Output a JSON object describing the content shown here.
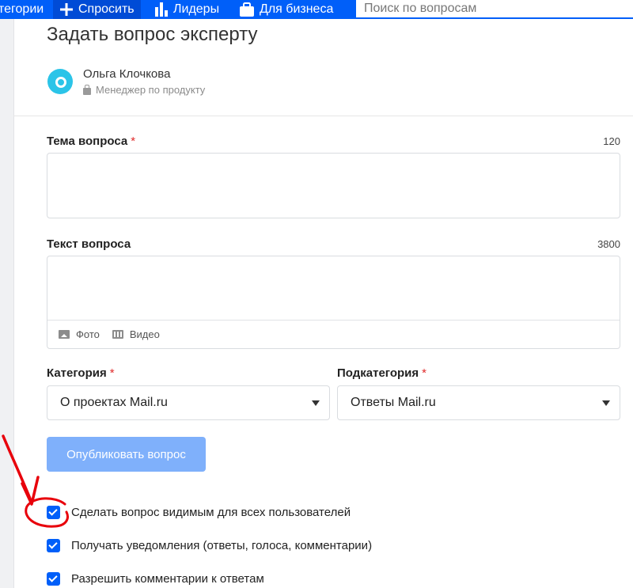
{
  "nav": {
    "categories_label": "тегории",
    "ask_label": "Спросить",
    "leaders_label": "Лидеры",
    "business_label": "Для бизнеса",
    "search_placeholder": "Поиск по вопросам",
    "icons": [
      "plus-icon",
      "bar-chart-icon",
      "briefcase-icon"
    ]
  },
  "page": {
    "title": "Задать вопрос эксперту"
  },
  "expert": {
    "name": "Ольга Клочкова",
    "role": "Менеджер по продукту"
  },
  "form": {
    "topic": {
      "label": "Тема вопроса",
      "required_mark": "*",
      "counter": "120",
      "value": ""
    },
    "text": {
      "label": "Текст вопроса",
      "counter": "3800",
      "value": "",
      "photo_label": "Фото",
      "video_label": "Видео"
    },
    "category": {
      "label": "Категория",
      "required_mark": "*",
      "value": "О проектах Mail.ru"
    },
    "subcategory": {
      "label": "Подкатегория",
      "required_mark": "*",
      "value": "Ответы Mail.ru"
    },
    "publish_label": "Опубликовать вопрос",
    "options": [
      {
        "label": "Сделать вопрос видимым для всех пользователей",
        "checked": true
      },
      {
        "label": "Получать уведомления (ответы, голоса, комментарии)",
        "checked": true
      },
      {
        "label": "Разрешить комментарии к ответам",
        "checked": true
      }
    ]
  },
  "colors": {
    "brand_blue": "#005ff9",
    "button_disabled_blue": "#7fb0fb",
    "required_red": "#e02b2b",
    "annotation_red": "#e8000b"
  }
}
